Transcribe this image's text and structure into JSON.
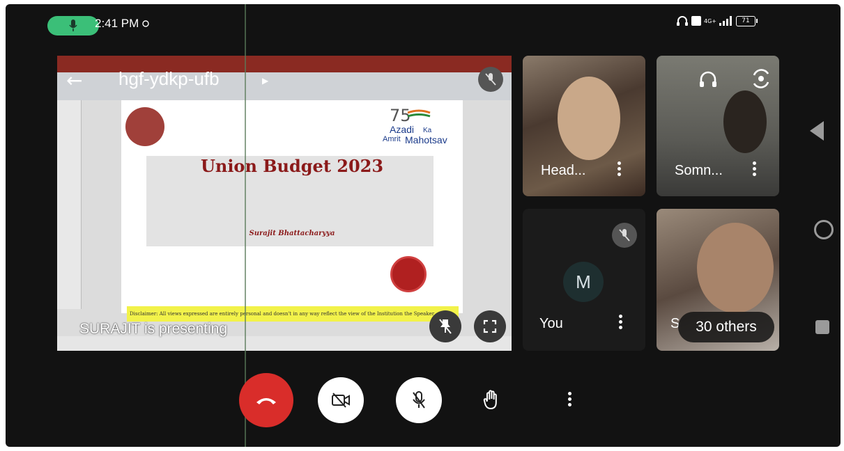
{
  "status_bar": {
    "time": "2:41 PM",
    "battery": "71",
    "network": "4G+"
  },
  "meeting": {
    "code": "hgf-ydkp-ufb",
    "presenting": "SURAJIT  is presenting"
  },
  "slide": {
    "title": "Union Budget 2023",
    "author": "Surajit Bhattacharyya",
    "logo_line1": "Azadi",
    "logo_line2": "Ka",
    "logo_line3": "Amrit",
    "logo_line4": "Mahotsav",
    "disclaimer": "Disclaimer: All views expressed are entirely personal and doesn't in any way reflect the view of the Institution the Speaker"
  },
  "participants": [
    {
      "name": "Head..."
    },
    {
      "name": "Somn..."
    },
    {
      "name": "You",
      "avatar_letter": "M"
    },
    {
      "name": "S"
    }
  ],
  "others_label": "30 others",
  "controls": {
    "end_call": "end-call",
    "camera": "camera-off",
    "mic": "mic-off",
    "hand": "raise-hand",
    "more": "more-options"
  },
  "colors": {
    "end_call": "#d92d2a",
    "mic_pill": "#3bbf78",
    "slide_title": "#8b1a1a"
  }
}
